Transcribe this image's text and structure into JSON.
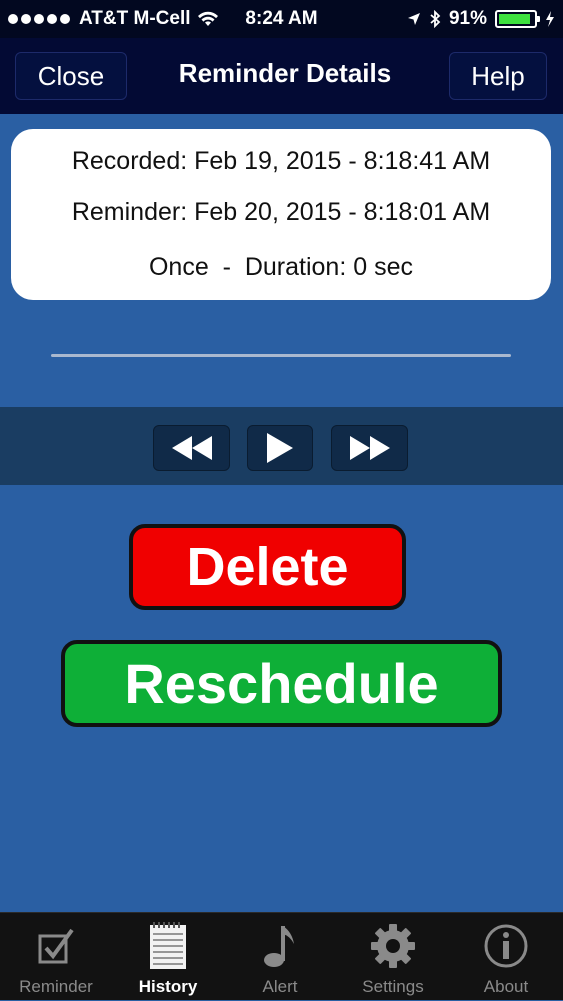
{
  "status": {
    "carrier": "AT&T M-Cell",
    "time": "8:24 AM",
    "battery": "91%",
    "battery_level": 0.91
  },
  "nav": {
    "close_label": "Close",
    "title": "Reminder Details",
    "help_label": "Help"
  },
  "details": {
    "recorded": "Recorded: Feb 19, 2015 - 8:18:41 AM",
    "reminder": "Reminder: Feb 20, 2015 - 8:18:01 AM",
    "repeat_duration": "Once  -  Duration: 0 sec"
  },
  "actions": {
    "delete_label": "Delete",
    "reschedule_label": "Reschedule"
  },
  "tabs": [
    {
      "label": "Reminder",
      "icon": "checkbox-icon",
      "active": false
    },
    {
      "label": "History",
      "icon": "notepad-icon",
      "active": true
    },
    {
      "label": "Alert",
      "icon": "music-note-icon",
      "active": false
    },
    {
      "label": "Settings",
      "icon": "gear-icon",
      "active": false
    },
    {
      "label": "About",
      "icon": "info-icon",
      "active": false
    }
  ],
  "colors": {
    "background": "#2a5fa3",
    "navbar": "#030a34",
    "delete": "#f00000",
    "reschedule": "#0eaf37"
  }
}
